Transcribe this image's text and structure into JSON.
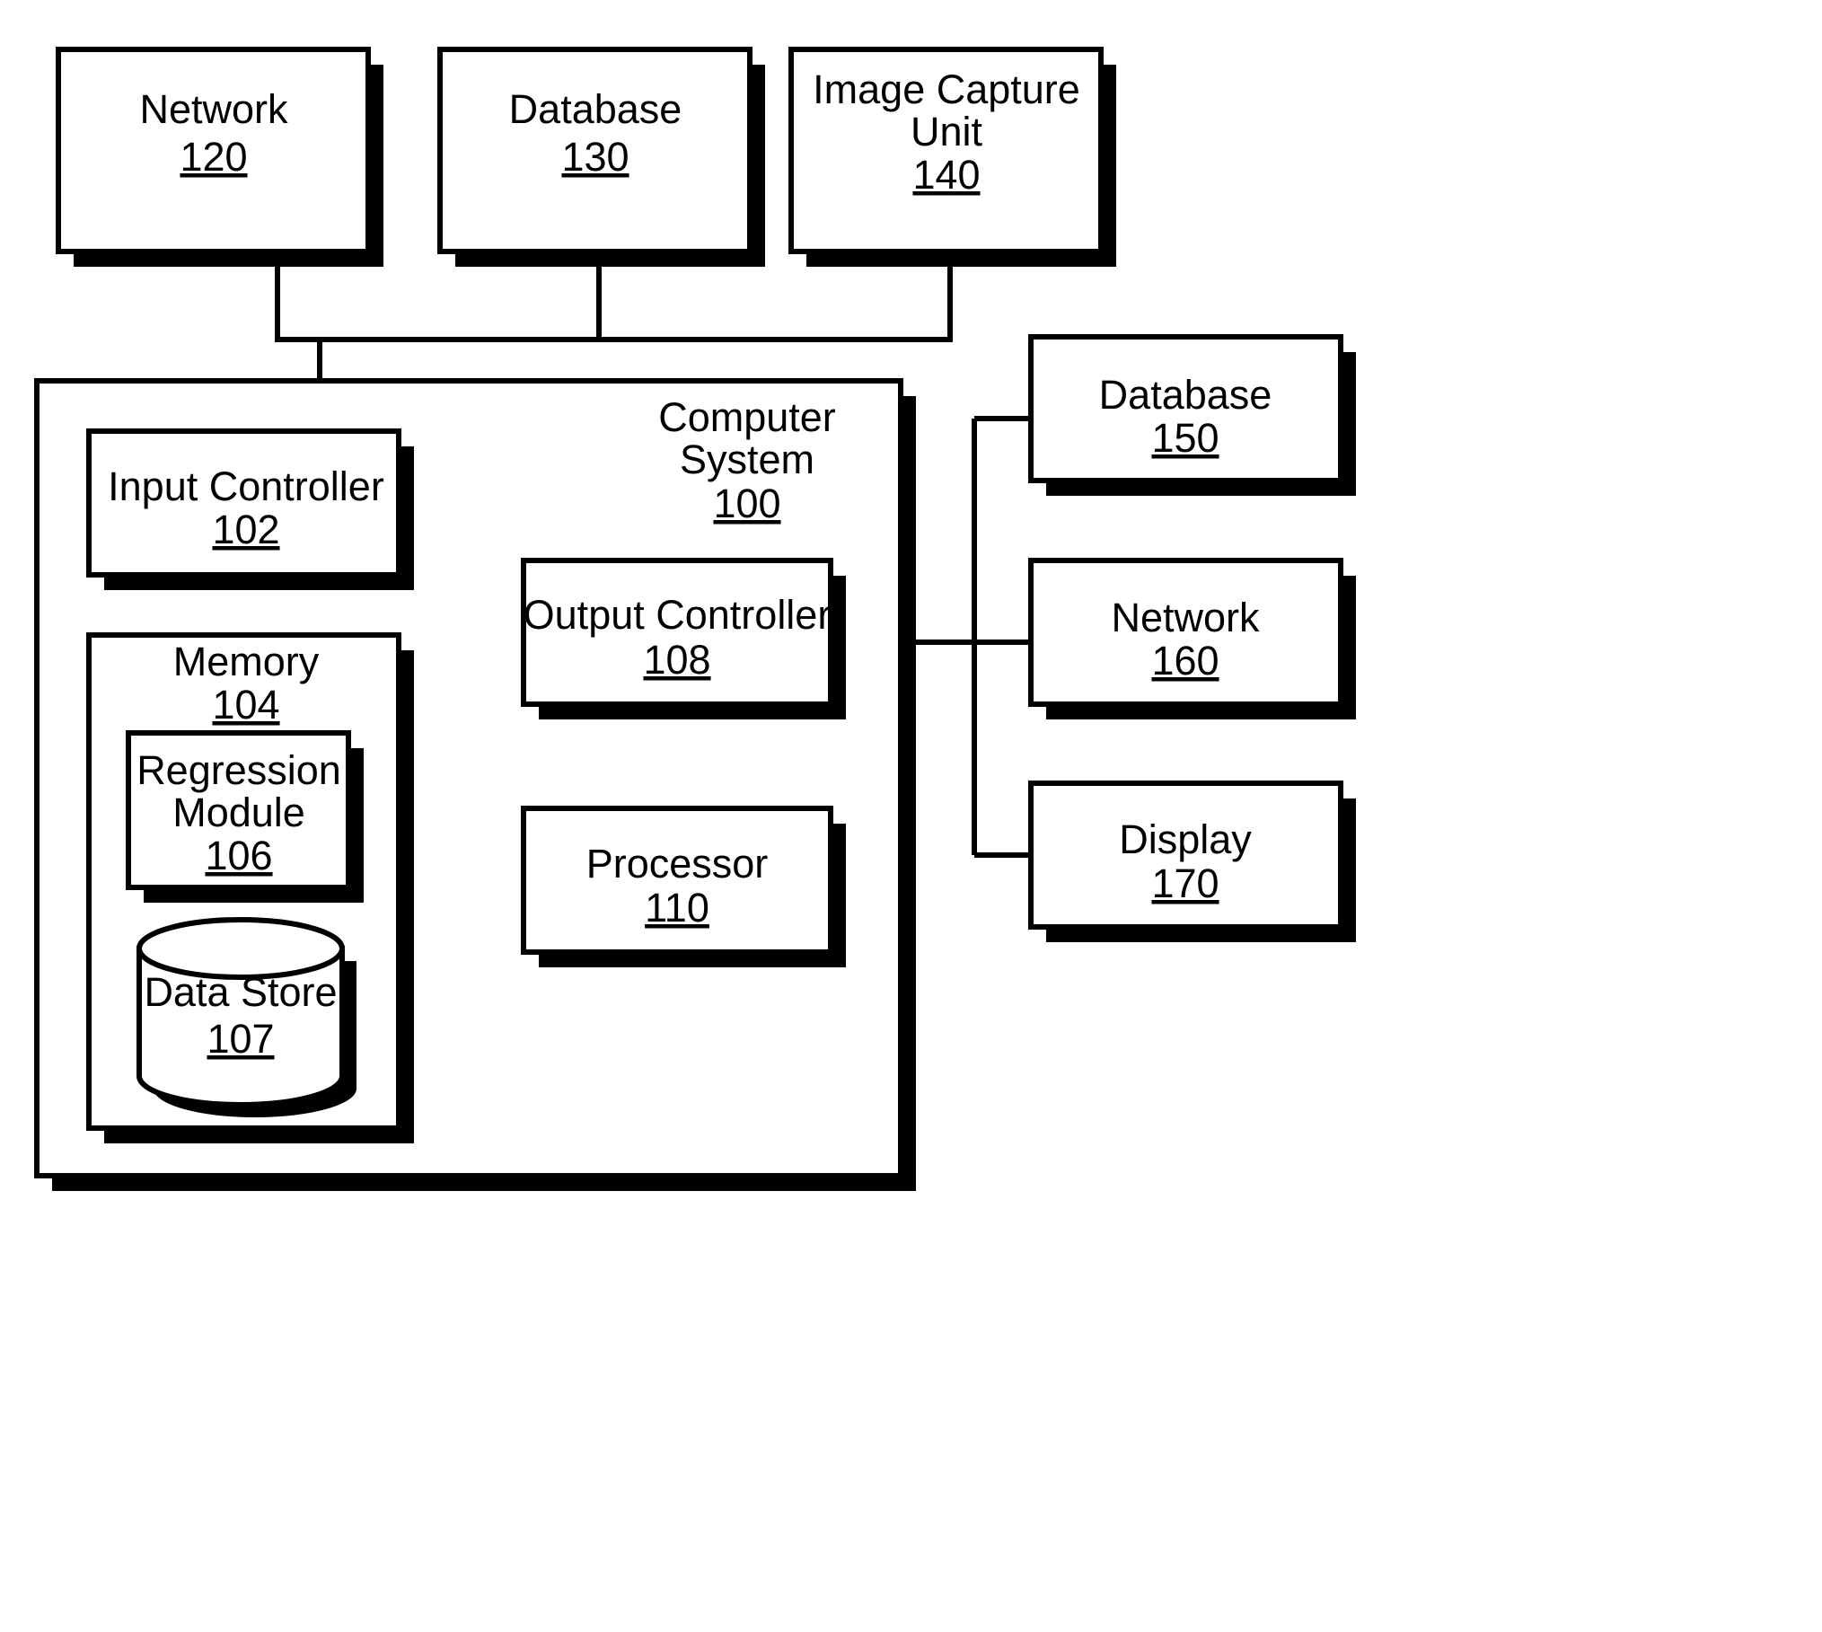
{
  "figure": {
    "type": "block-diagram",
    "title": "Computer System Block Diagram"
  },
  "blocks": {
    "network_120": {
      "label": "Network",
      "number": "120"
    },
    "database_130": {
      "label": "Database",
      "number": "130"
    },
    "image_capture_140": {
      "label_line1": "Image Capture",
      "label_line2": "Unit",
      "number": "140"
    },
    "computer_system_100": {
      "label_line1": "Computer",
      "label_line2": "System",
      "number": "100"
    },
    "input_controller_102": {
      "label": "Input Controller",
      "number": "102"
    },
    "memory_104": {
      "label": "Memory",
      "number": "104"
    },
    "regression_module_106": {
      "label_line1": "Regression",
      "label_line2": "Module",
      "number": "106"
    },
    "data_store_107": {
      "label": "Data Store",
      "number": "107"
    },
    "output_controller_108": {
      "label": "Output Controller",
      "number": "108"
    },
    "processor_110": {
      "label": "Processor",
      "number": "110"
    },
    "database_150": {
      "label": "Database",
      "number": "150"
    },
    "network_160": {
      "label": "Network",
      "number": "160"
    },
    "display_170": {
      "label": "Display",
      "number": "170"
    }
  },
  "colors": {
    "stroke": "#000000",
    "fill": "#ffffff",
    "shadow": "#000000"
  }
}
